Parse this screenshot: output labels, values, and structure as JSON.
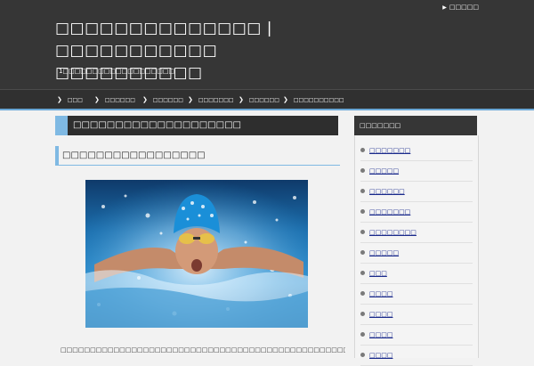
{
  "header": {
    "top_link": "□□□□□",
    "site_title": "□□□□□□□□□□□□□□ | □□□□□□□□□□□ □□□□□□□□□□",
    "tagline": "1□□□□□□□□□□□□□□□□□□□"
  },
  "nav": {
    "items": [
      {
        "label": "□□□"
      },
      {
        "label": "□□□□□□"
      },
      {
        "label": "□□□□□□"
      },
      {
        "label": "□□□□□□□"
      },
      {
        "label": "□□□□□□"
      },
      {
        "label": "□□□□□□□□□□"
      }
    ]
  },
  "main": {
    "category_title": "□□□□□□□□□□□□□□□□□□□□",
    "article_title": "□□□□□□□□□□□□□□□□□",
    "photo_alt": "swimmer-photo",
    "body_text": "□□□□□□□□□□□□□□□□□□□□□□□□□□□□□□□□□□□□□□□□□□□□□□□□□□□□□□□□□□□□□□□□□□□□□"
  },
  "sidebar": {
    "title": "□□□□□□□",
    "items": [
      {
        "label": "□□□□□□□"
      },
      {
        "label": "□□□□□"
      },
      {
        "label": "□□□□□□"
      },
      {
        "label": "□□□□□□□"
      },
      {
        "label": "□□□□□□□□"
      },
      {
        "label": "□□□□□"
      },
      {
        "label": "□□□"
      },
      {
        "label": "□□□□"
      },
      {
        "label": "□□□□"
      },
      {
        "label": "□□□□"
      },
      {
        "label": "□□□□"
      }
    ]
  }
}
